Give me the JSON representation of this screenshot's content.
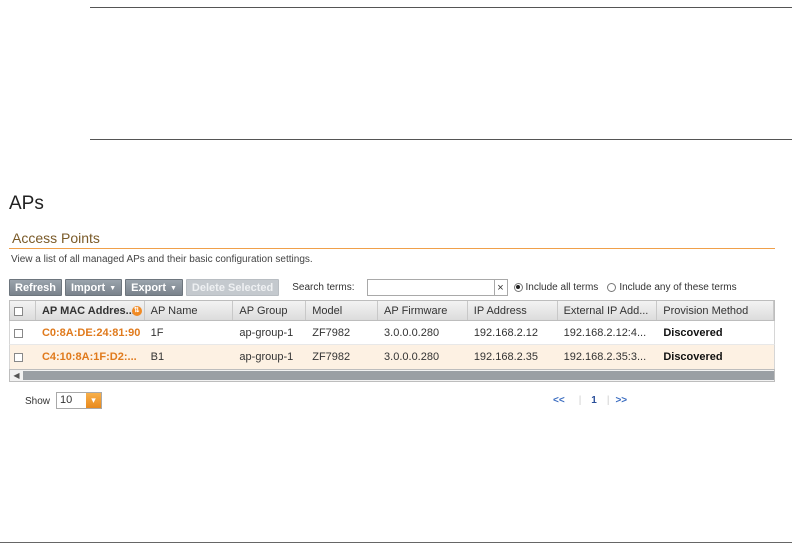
{
  "page": {
    "title": "APs"
  },
  "section": {
    "title": "Access Points",
    "description": "View a list of all managed APs and their basic configuration settings."
  },
  "toolbar": {
    "refresh": "Refresh",
    "import": "Import",
    "export": "Export",
    "delete_selected": "Delete Selected",
    "search_label": "Search terms:",
    "search_value": "",
    "clear": "×",
    "include_all": "Include all terms",
    "include_any": "Include any of these terms"
  },
  "table": {
    "columns": [
      "AP MAC Addres...",
      "AP Name",
      "AP Group",
      "Model",
      "AP Firmware",
      "IP Address",
      "External IP Add...",
      "Provision Method"
    ],
    "rows": [
      [
        "C0:8A:DE:24:81:90",
        "1F",
        "ap-group-1",
        "ZF7982",
        "3.0.0.0.280",
        "192.168.2.12",
        "192.168.2.12:4...",
        "Discovered"
      ],
      [
        "C4:10:8A:1F:D2:...",
        "B1",
        "ap-group-1",
        "ZF7982",
        "3.0.0.0.280",
        "192.168.2.35",
        "192.168.2.35:3...",
        "Discovered"
      ]
    ]
  },
  "paging": {
    "show_label": "Show",
    "page_size": "10",
    "prev": "<<",
    "current": "1",
    "next": ">>"
  },
  "icons": {
    "sort": "sort-icon",
    "dropdown": "chevron-down-icon",
    "scroll_left": "scroll-left-icon"
  },
  "colors": {
    "accent": "#e07a1c",
    "row_alt": "#fdf1e3",
    "button": "#8a929a"
  }
}
